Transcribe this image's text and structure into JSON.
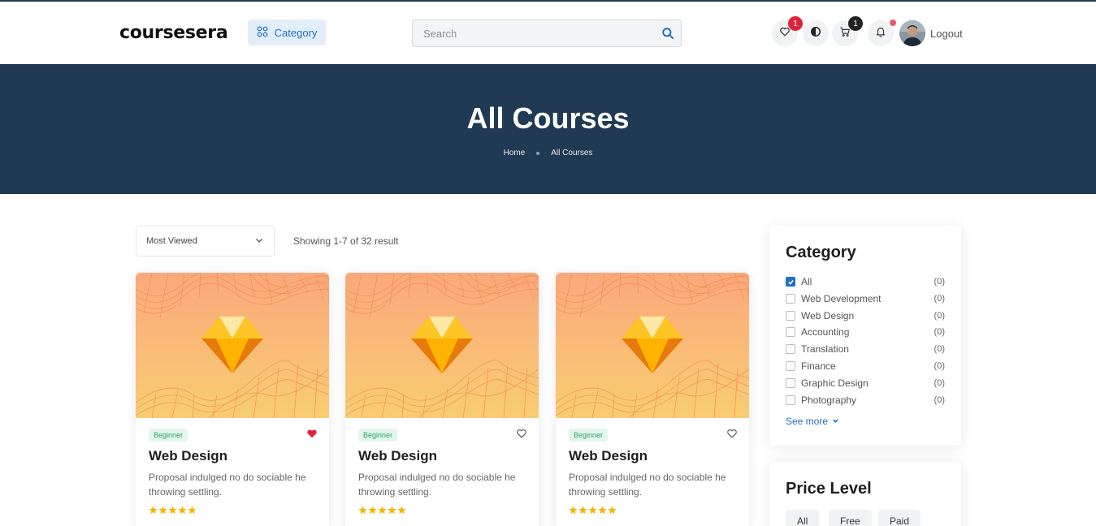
{
  "header": {
    "logo": "coursesera",
    "category_button": "Category",
    "search_placeholder": "Search",
    "wishlist_count": "1",
    "cart_count": "1",
    "logout": "Logout"
  },
  "hero": {
    "title": "All Courses",
    "breadcrumb": [
      "Home",
      "All Courses"
    ]
  },
  "toolbar": {
    "sort_selected": "Most Viewed",
    "showing": "Showing 1-7 of 32 result"
  },
  "courses": [
    {
      "level": "Beginner",
      "title": "Web Design",
      "description": "Proposal indulged no do sociable he throwing settling.",
      "rating": 5,
      "favorited": true
    },
    {
      "level": "Beginner",
      "title": "Web Design",
      "description": "Proposal indulged no do sociable he throwing settling.",
      "rating": 5,
      "favorited": false
    },
    {
      "level": "Beginner",
      "title": "Web Design",
      "description": "Proposal indulged no do sociable he throwing settling.",
      "rating": 5,
      "favorited": false
    }
  ],
  "sidebar": {
    "category": {
      "title": "Category",
      "items": [
        {
          "label": "All",
          "count": "(0)",
          "checked": true
        },
        {
          "label": "Web Development",
          "count": "(0)",
          "checked": false
        },
        {
          "label": "Web Design",
          "count": "(0)",
          "checked": false
        },
        {
          "label": "Accounting",
          "count": "(0)",
          "checked": false
        },
        {
          "label": "Translation",
          "count": "(0)",
          "checked": false
        },
        {
          "label": "Finance",
          "count": "(0)",
          "checked": false
        },
        {
          "label": "Graphic Design",
          "count": "(0)",
          "checked": false
        },
        {
          "label": "Photography",
          "count": "(0)",
          "checked": false
        }
      ],
      "see_more": "See more"
    },
    "price": {
      "title": "Price Level",
      "options": [
        "All",
        "Free",
        "Paid"
      ]
    }
  },
  "colors": {
    "accent": "#1f6fc5",
    "hero_bg": "#1f3a52",
    "badge_red": "#e0243c",
    "star": "#f5b700",
    "level_green": "#28a466"
  },
  "icons": {
    "category": "grid-icon",
    "search": "search-icon",
    "wishlist": "heart-icon",
    "theme": "contrast-icon",
    "cart": "cart-icon",
    "notifications": "bell-icon",
    "sort": "chevron-down-icon",
    "course_thumb": "gem-icon",
    "rating": "star-icon"
  }
}
